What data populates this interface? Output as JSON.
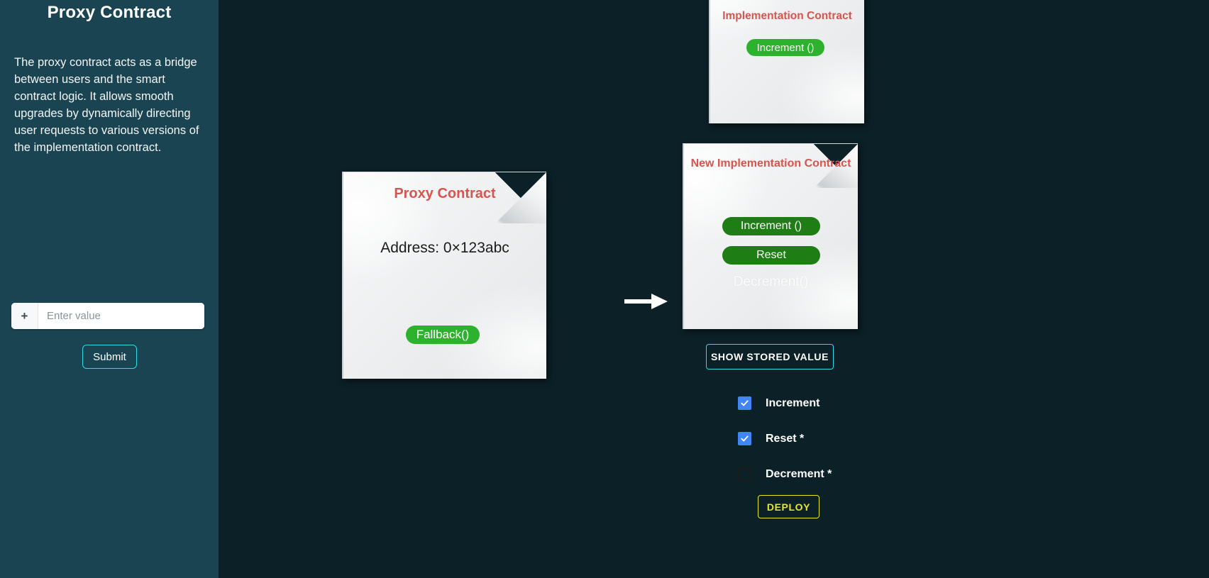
{
  "sidebar": {
    "title": "Proxy Contract",
    "description": "The proxy contract acts as a bridge between users and the smart contract logic. It allows smooth upgrades by dynamically directing user requests to various versions of the implementation contract.",
    "value_input": {
      "addon_label": "+",
      "placeholder": "Enter value",
      "value": ""
    },
    "submit_label": "Submit"
  },
  "main": {
    "implementation_card": {
      "title": "Implementation Contract",
      "pill_label": "Increment ()"
    },
    "proxy_card": {
      "title": "Proxy Contract",
      "address": "Address: 0×123abc",
      "pill_label": "Fallback()"
    },
    "new_implementation_card": {
      "title": "New Implementation Contract",
      "pill_increment": "Increment ()",
      "pill_reset": "Reset",
      "ghost_decrement": "Decrement()"
    },
    "arrow_icon": "arrow-right-icon",
    "show_stored_value_label": "SHOW STORED VALUE",
    "checkboxes": [
      {
        "label": "Increment",
        "checked": true
      },
      {
        "label": "Reset *",
        "checked": true
      },
      {
        "label": "Decrement *",
        "checked": false
      }
    ],
    "deploy_label": "DEPLOY"
  },
  "colors": {
    "sidebar_bg": "#1a4452",
    "main_bg": "#0b2027",
    "accent_cyan": "#2fd9e8",
    "accent_yellow": "#e8e821",
    "card_title_red": "#d9534f",
    "pill_bright_green": "#2cb22c",
    "pill_dark_green": "#1f7d16",
    "checkbox_blue": "#4285f4"
  }
}
